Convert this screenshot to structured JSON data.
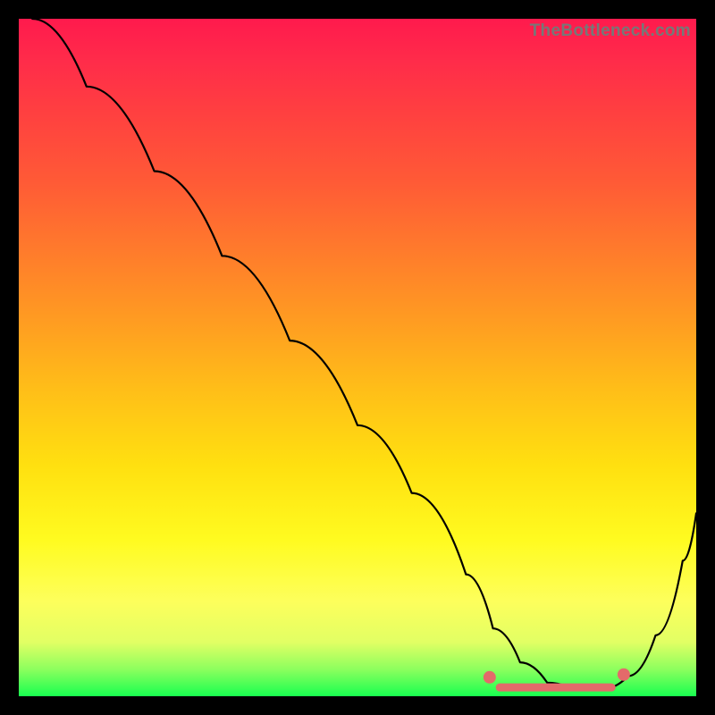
{
  "attribution": "TheBottleneck.com",
  "chart_data": {
    "type": "line",
    "title": "",
    "xlabel": "",
    "ylabel": "",
    "xlim": [
      0,
      100
    ],
    "ylim": [
      0,
      100
    ],
    "series": [
      {
        "name": "bottleneck-curve",
        "x": [
          2,
          10,
          20,
          30,
          40,
          50,
          58,
          66,
          70,
          74,
          78,
          82,
          86,
          90,
          94,
          98,
          100
        ],
        "values": [
          100,
          90,
          77.5,
          65,
          52.5,
          40,
          30,
          18,
          10,
          5,
          2,
          1,
          1,
          3,
          9,
          20,
          27
        ]
      }
    ],
    "highlight": {
      "name": "optimal-range",
      "bar_x": [
        71,
        87.5
      ],
      "bar_y": 1.3,
      "dots": [
        {
          "x": 69.5,
          "y": 2.8
        },
        {
          "x": 89.3,
          "y": 3.2
        }
      ]
    }
  }
}
